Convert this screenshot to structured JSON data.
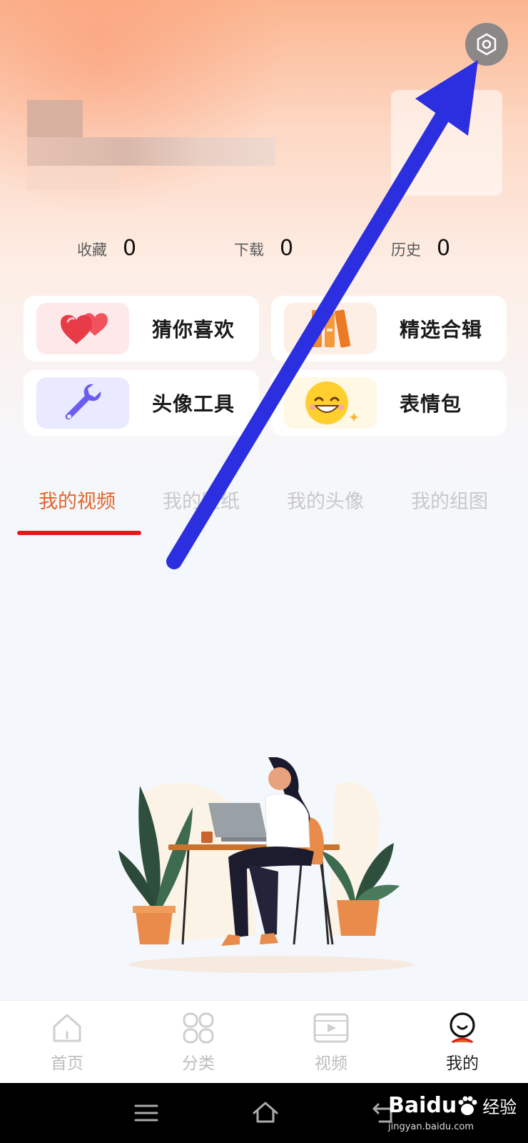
{
  "header": {
    "settings_icon": "settings-hex-icon"
  },
  "stats": [
    {
      "label": "收藏",
      "value": "0"
    },
    {
      "label": "下载",
      "value": "0"
    },
    {
      "label": "历史",
      "value": "0"
    }
  ],
  "shortcuts": [
    {
      "label": "猜你喜欢",
      "icon": "hearts-icon"
    },
    {
      "label": "精选合辑",
      "icon": "books-icon"
    },
    {
      "label": "头像工具",
      "icon": "wrench-icon"
    },
    {
      "label": "表情包",
      "icon": "smiley-icon"
    }
  ],
  "tabs": [
    {
      "label": "我的视频",
      "active": true
    },
    {
      "label": "我的壁纸",
      "active": false
    },
    {
      "label": "我的头像",
      "active": false
    },
    {
      "label": "我的组图",
      "active": false
    }
  ],
  "bottom_nav": [
    {
      "label": "首页",
      "icon": "home-icon",
      "active": false
    },
    {
      "label": "分类",
      "icon": "grid-icon",
      "active": false
    },
    {
      "label": "视频",
      "icon": "video-icon",
      "active": false
    },
    {
      "label": "我的",
      "icon": "profile-icon",
      "active": true
    }
  ],
  "watermark": {
    "brand": "Baidu",
    "cn": "经验",
    "url": "jingyan.baidu.com"
  },
  "colors": {
    "accent": "#e2652a",
    "indicator": "#e21a1a",
    "annotation_arrow": "#2b2fe0"
  }
}
